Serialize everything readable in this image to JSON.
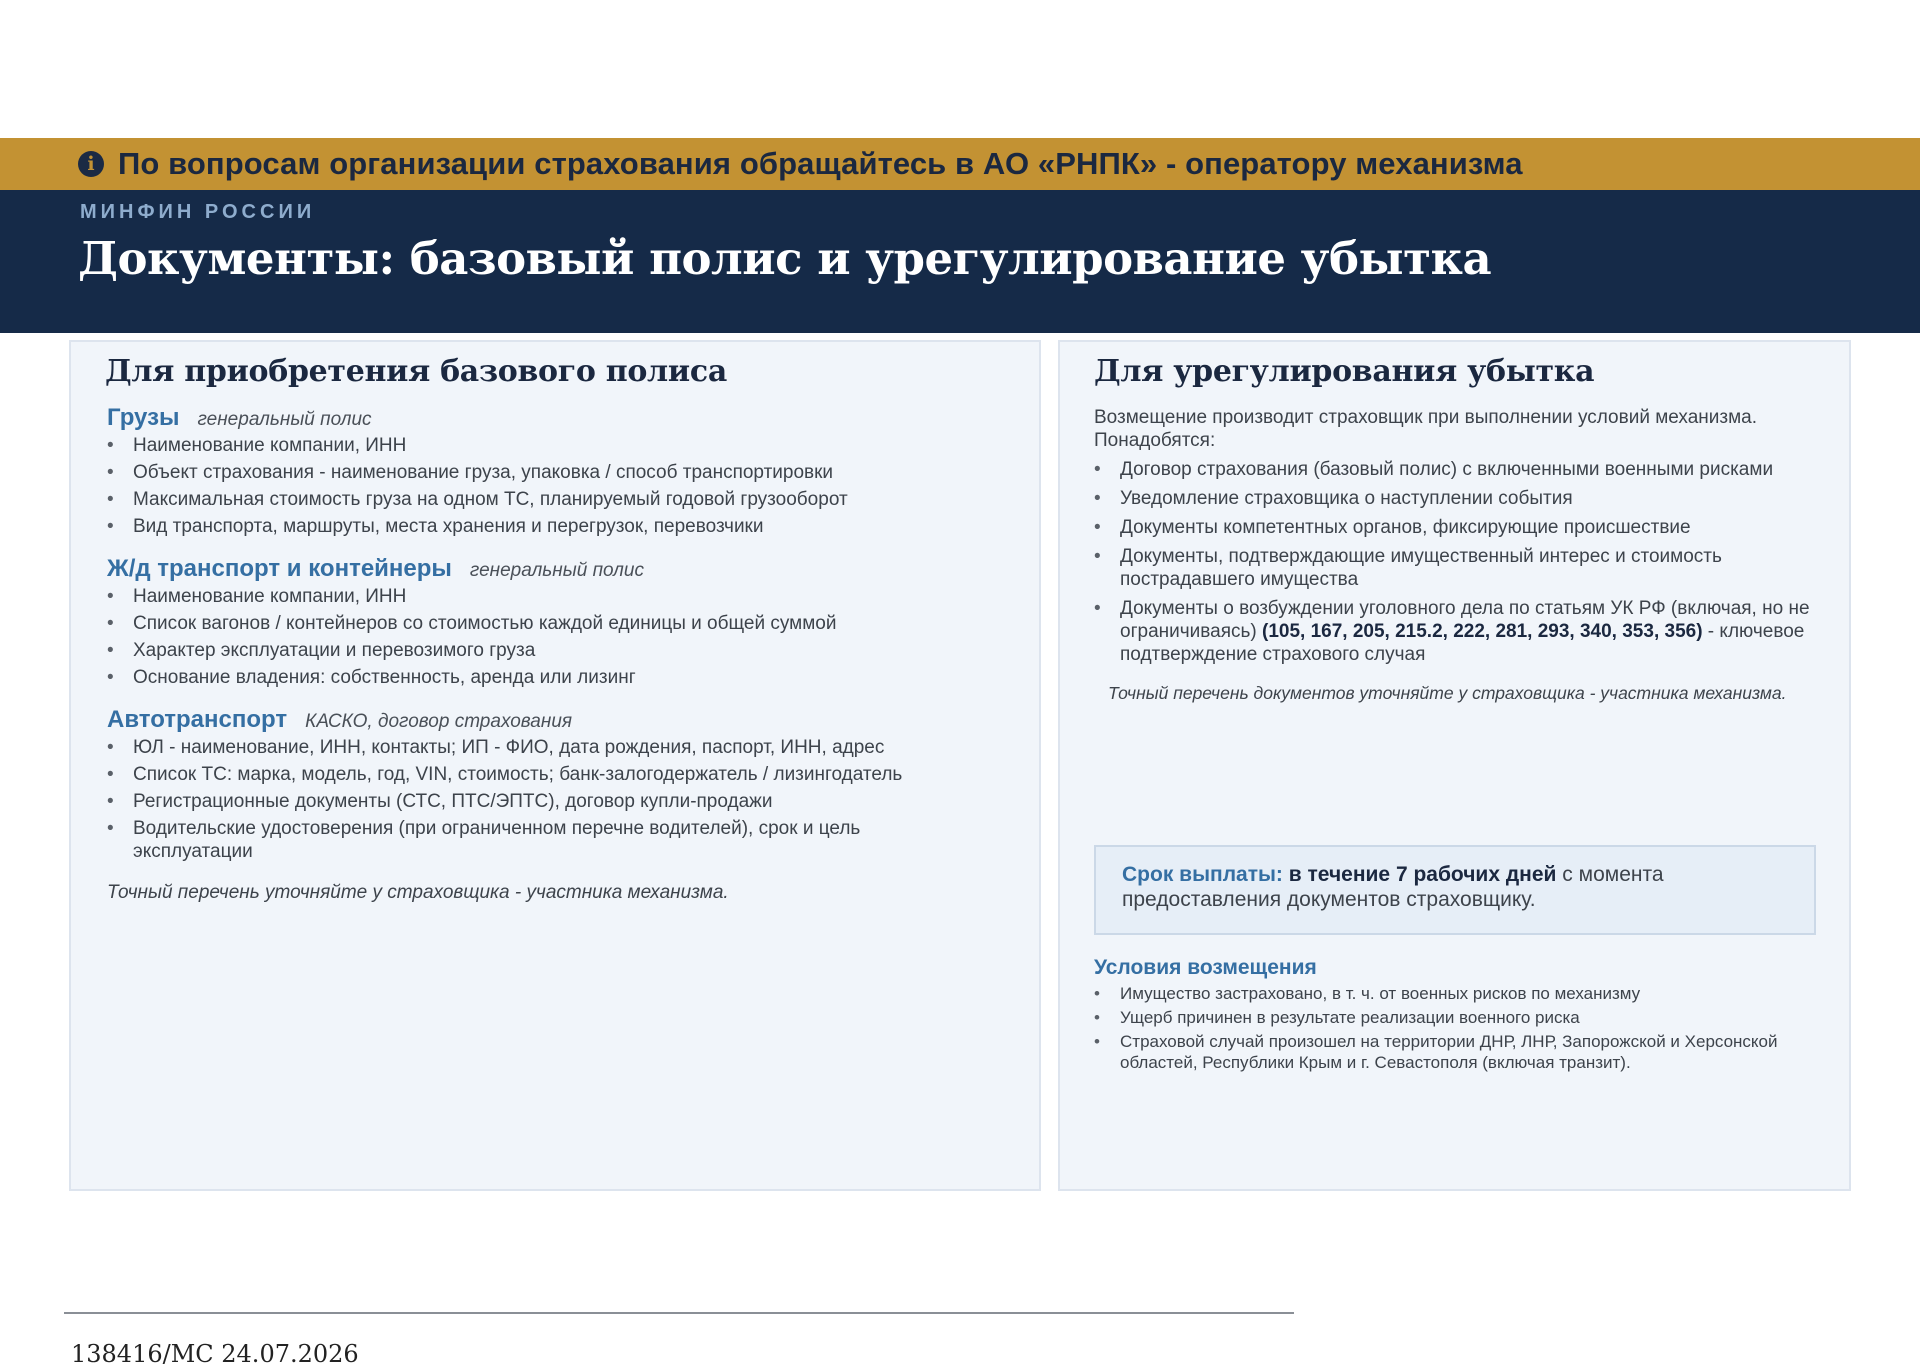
{
  "banner": {
    "icon": "info-icon",
    "text": "По вопросам организации страхования обращайтесь в АО «РНПК» - оператору механизма"
  },
  "header": {
    "kicker": "МИНФИН РОССИИ",
    "title": "Документы: базовый полис и урегулирование убытка"
  },
  "left": {
    "title": "Для приобретения базового полиса",
    "sections": [
      {
        "title": "Грузы",
        "subtitle": "генеральный полис",
        "items": [
          "Наименование компании, ИНН",
          "Объект страхования - наименование груза, упаковка / способ транспортировки",
          "Максимальная стоимость груза на одном ТС, планируемый годовой грузооборот",
          "Вид транспорта, маршруты, места хранения и перегрузок, перевозчики"
        ]
      },
      {
        "title": "Ж/д транспорт и контейнеры",
        "subtitle": "генеральный полис",
        "items": [
          "Наименование компании, ИНН",
          "Список вагонов / контейнеров со стоимостью каждой единицы и общей суммой",
          "Характер эксплуатации и перевозимого груза",
          "Основание владения: собственность, аренда или лизинг"
        ]
      },
      {
        "title": "Автотранспорт",
        "subtitle": "КАСКО, договор страхования",
        "items": [
          "ЮЛ - наименование, ИНН, контакты; ИП - ФИО, дата рождения, паспорт, ИНН, адрес",
          "Список ТС: марка, модель, год, VIN, стоимость; банк-залогодержатель / лизингодатель",
          "Регистрационные документы (СТС, ПТС/ЭПТС), договор купли-продажи",
          "Водительские удостоверения (при ограниченном перечне водителей), срок и цель эксплуатации"
        ]
      }
    ],
    "note": "Точный перечень уточняйте у страховщика - участника механизма."
  },
  "right": {
    "title": "Для урегулирования убытка",
    "intro": "Возмещение производит страховщик при выполнении условий механизма. Понадобятся:",
    "items": [
      "Договор страхования (базовый полис) с включенными военными рисками",
      "Уведомление страховщика о наступлении события",
      "Документы компетентных органов, фиксирующие происшествие",
      "Документы, подтверждающие имущественный интерес и стоимость пострадавшего имущества"
    ],
    "last_item": {
      "before": "Документы о возбуждении уголовного дела по статьям УК РФ (включая, но не ограничиваясь) ",
      "articles": "(105, 167, 205, 215.2, 222, 281, 293, 340, 353, 356)",
      "after": " - ключевое подтверждение страхового случая"
    },
    "note": "Точный перечень документов уточняйте у страховщика - участника механизма.",
    "payout": {
      "label": "Срок выплаты:",
      "highlight": "в течение 7 рабочих дней",
      "rest": " с момента предоставления документов страховщику."
    },
    "conditions_title": "Условия возмещения",
    "conditions": [
      "Имущество застраховано, в т. ч. от военных рисков по механизму",
      "Ущерб причинен в результате реализации военного риска",
      "Страховой случай произошел на территории ДНР, ЛНР, Запорожской и Херсонской областей, Республики Крым и г. Севастополя (включая транзит)."
    ]
  },
  "footer": {
    "text": "138416/MC 24.07.2026"
  }
}
